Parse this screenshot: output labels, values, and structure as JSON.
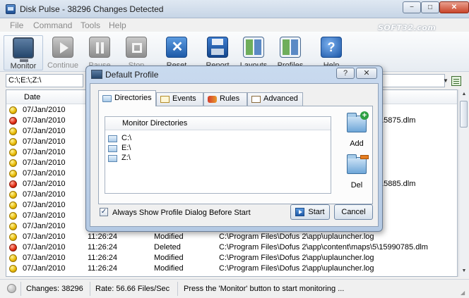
{
  "window": {
    "title": "Disk Pulse - 38296 Changes Detected",
    "controls": [
      "−",
      "□",
      "✕"
    ]
  },
  "menu": [
    "File",
    "Command",
    "Tools",
    "Help"
  ],
  "toolbar": {
    "monitor": "Monitor",
    "continue": "Continue",
    "pause": "Pause",
    "stop": "Stop",
    "reset": "Reset",
    "report": "Report",
    "layouts": "Layouts",
    "profiles": "Profiles",
    "help": "Help"
  },
  "watermark": "SOFT32.com",
  "pathbar": {
    "value": "C:\\;E:\\;Z:\\"
  },
  "list": {
    "header_date": "Date",
    "rows": [
      {
        "status": "yellow",
        "date": "07/Jan/2010",
        "time": "",
        "type": "",
        "path": "",
        "frag": ""
      },
      {
        "status": "red",
        "date": "07/Jan/2010",
        "time": "",
        "type": "",
        "path": "",
        "frag": "15875.dlm"
      },
      {
        "status": "yellow",
        "date": "07/Jan/2010",
        "time": "",
        "type": "",
        "path": "",
        "frag": ""
      },
      {
        "status": "yellow",
        "date": "07/Jan/2010",
        "time": "",
        "type": "",
        "path": "",
        "frag": ""
      },
      {
        "status": "yellow",
        "date": "07/Jan/2010",
        "time": "",
        "type": "",
        "path": "",
        "frag": ""
      },
      {
        "status": "yellow",
        "date": "07/Jan/2010",
        "time": "",
        "type": "",
        "path": "",
        "frag": ""
      },
      {
        "status": "yellow",
        "date": "07/Jan/2010",
        "time": "",
        "type": "",
        "path": "",
        "frag": ""
      },
      {
        "status": "red",
        "date": "07/Jan/2010",
        "time": "",
        "type": "",
        "path": "",
        "frag": "15885.dlm"
      },
      {
        "status": "yellow",
        "date": "07/Jan/2010",
        "time": "",
        "type": "",
        "path": "",
        "frag": ""
      },
      {
        "status": "yellow",
        "date": "07/Jan/2010",
        "time": "",
        "type": "",
        "path": "",
        "frag": ""
      },
      {
        "status": "yellow",
        "date": "07/Jan/2010",
        "time": "",
        "type": "",
        "path": "",
        "frag": ""
      },
      {
        "status": "yellow",
        "date": "07/Jan/2010",
        "time": "",
        "type": "",
        "path": "",
        "frag": ""
      },
      {
        "status": "yellow",
        "date": "07/Jan/2010",
        "time": "11:26:24",
        "type": "Modified",
        "path": "C:\\Program Files\\Dofus 2\\app\\uplauncher.log",
        "frag": ""
      },
      {
        "status": "red",
        "date": "07/Jan/2010",
        "time": "11:26:24",
        "type": "Deleted",
        "path": "C:\\Program Files\\Dofus 2\\app\\content\\maps\\5\\15990785.dlm",
        "frag": ""
      },
      {
        "status": "yellow",
        "date": "07/Jan/2010",
        "time": "11:26:24",
        "type": "Modified",
        "path": "C:\\Program Files\\Dofus 2\\app\\uplauncher.log",
        "frag": ""
      },
      {
        "status": "yellow",
        "date": "07/Jan/2010",
        "time": "11:26:24",
        "type": "Modified",
        "path": "C:\\Program Files\\Dofus 2\\app\\uplauncher.log",
        "frag": ""
      }
    ]
  },
  "statusbar": {
    "changes": "Changes: 38296",
    "rate": "Rate: 56.66 Files/Sec",
    "message": "Press the 'Monitor' button to start monitoring ..."
  },
  "dialog": {
    "title": "Default Profile",
    "help_button": "?",
    "close_button": "✕",
    "tabs": [
      "Directories",
      "Events",
      "Rules",
      "Advanced"
    ],
    "dir_header": "Monitor Directories",
    "directories": [
      "C:\\",
      "E:\\",
      "Z:\\"
    ],
    "add_label": "Add",
    "del_label": "Del",
    "checkbox_label": "Always Show Profile Dialog Before Start",
    "checkbox_checked": true,
    "start_label": "Start",
    "cancel_label": "Cancel"
  },
  "colors": {
    "status_yellow": "#e7b800",
    "status_red": "#e02810",
    "accent": "#1e5aa8"
  }
}
